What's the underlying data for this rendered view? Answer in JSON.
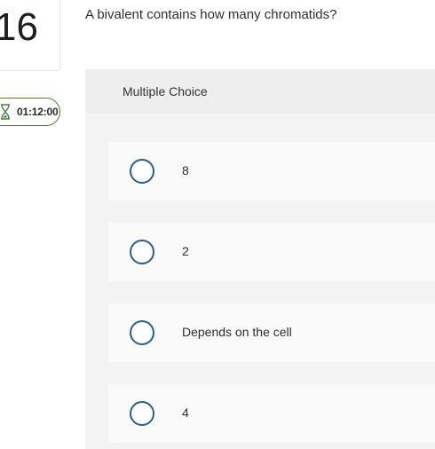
{
  "question": {
    "number": "16",
    "text": "A bivalent contains how many chromatids?"
  },
  "timer": {
    "icon": "hourglass-icon",
    "value": "01:12:00"
  },
  "answer_panel": {
    "type_label": "Multiple Choice",
    "options": [
      {
        "label": "8",
        "selected": false
      },
      {
        "label": "2",
        "selected": false
      },
      {
        "label": "Depends on the cell",
        "selected": false
      },
      {
        "label": "4",
        "selected": false
      }
    ]
  },
  "colors": {
    "timer_border": "#4f7a45",
    "radio_border": "#2b5f86",
    "panel_background": "#f3f3f3",
    "option_background": "#fafafa"
  }
}
